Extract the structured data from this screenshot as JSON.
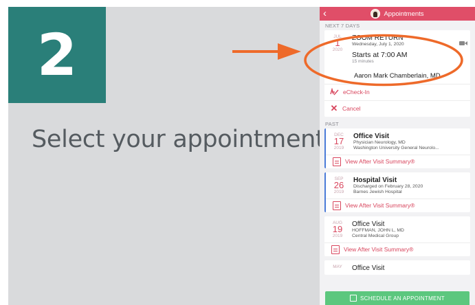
{
  "slide": {
    "step_number": "2",
    "instruction": "Select your appointment."
  },
  "nav": {
    "back_icon": "chevron-left-icon",
    "title": "Appointments"
  },
  "upcoming": {
    "section_label": "NEXT 7 DAYS",
    "appointment": {
      "month": "JUL",
      "day": "1",
      "year": "2020",
      "title": "ZOOM RETURN",
      "date_text": "Wednesday, July 1, 2020",
      "starts": "Starts at 7:00 AM",
      "duration": "15 minutes",
      "provider": "Aaron Mark Chamberlain, MD",
      "video_icon": "video-camera-icon"
    },
    "actions": {
      "echeckin": "eCheck-In",
      "cancel": "Cancel"
    }
  },
  "past": {
    "section_label": "PAST",
    "items": [
      {
        "month": "DEC",
        "day": "17",
        "year": "2019",
        "title": "Office Visit",
        "line1": "Physician Neurology, MD",
        "line2": "Washington University General Neurolo...",
        "summary": "View After Visit Summary®"
      },
      {
        "month": "SEP",
        "day": "26",
        "year": "2019",
        "title": "Hospital Visit",
        "line1": "Discharged on February 28, 2020",
        "line2": "Barnes Jewish Hospital",
        "summary": "View After Visit Summary®"
      },
      {
        "month": "AUG",
        "day": "19",
        "year": "2019",
        "title": "Office Visit",
        "line1": "HOFFMAN, JOHN L, MD",
        "line2": "Central Medical Group",
        "summary": "View After Visit Summary®"
      },
      {
        "month": "MAY",
        "title": "Office Visit"
      }
    ]
  },
  "cta": {
    "label": "SCHEDULE AN APPOINTMENT"
  },
  "colors": {
    "teal": "#2a7f79",
    "nav_pink": "#e04e68",
    "accent_red": "#d8455d",
    "annotation_orange": "#ee6a2a",
    "cta_green": "#5cc77e"
  }
}
